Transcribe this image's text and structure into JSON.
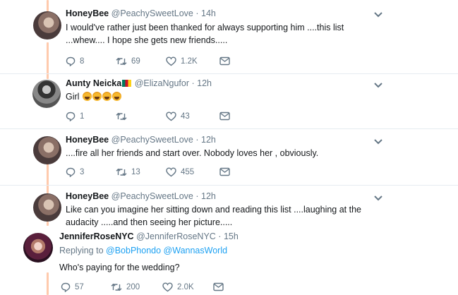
{
  "tweets": [
    {
      "name": "HoneyBee",
      "handle": "@PeachySweetLove",
      "time": "14h",
      "text_line1": "I would've rather just been thanked for always supporting him ....this list",
      "text_line2": "...whew.... I hope she gets new friends.....",
      "replies": "8",
      "retweets": "69",
      "likes": "1.2K"
    },
    {
      "name": "Aunty Neicka",
      "handle": "@ElizaNgufor",
      "time": "12h",
      "text_line1": "Girl",
      "emoji": "face-with-tears-of-joy",
      "emoji_count": 4,
      "replies": "1",
      "retweets": "",
      "likes": "43"
    },
    {
      "name": "HoneyBee",
      "handle": "@PeachySweetLove",
      "time": "12h",
      "text_line1": "....fire all her friends and start over. Nobody loves her , obviously.",
      "replies": "3",
      "retweets": "13",
      "likes": "455"
    },
    {
      "name": "HoneyBee",
      "handle": "@PeachySweetLove",
      "time": "12h",
      "text_line1": "Like can you imagine her sitting down and reading this list ....laughing at the",
      "text_line2": "audacity .....and then seeing her picture....."
    },
    {
      "name": "JenniferRoseNYC",
      "handle": "@JenniferRoseNYC",
      "time": "15h",
      "reply_prefix": "Replying to",
      "mention1": "@BobPhondo",
      "mention2": "@WannasWorld",
      "text_line1": "Who's paying for the wedding?",
      "replies": "57",
      "retweets": "200",
      "likes": "2.0K"
    }
  ],
  "separator": "·",
  "colors": {
    "thread_line": "#ffcaad",
    "secondary_text": "#657786",
    "link": "#1da1f2"
  },
  "icons": [
    "reply-icon",
    "retweet-icon",
    "like-icon",
    "direct-message-icon",
    "chevron-down-icon"
  ]
}
